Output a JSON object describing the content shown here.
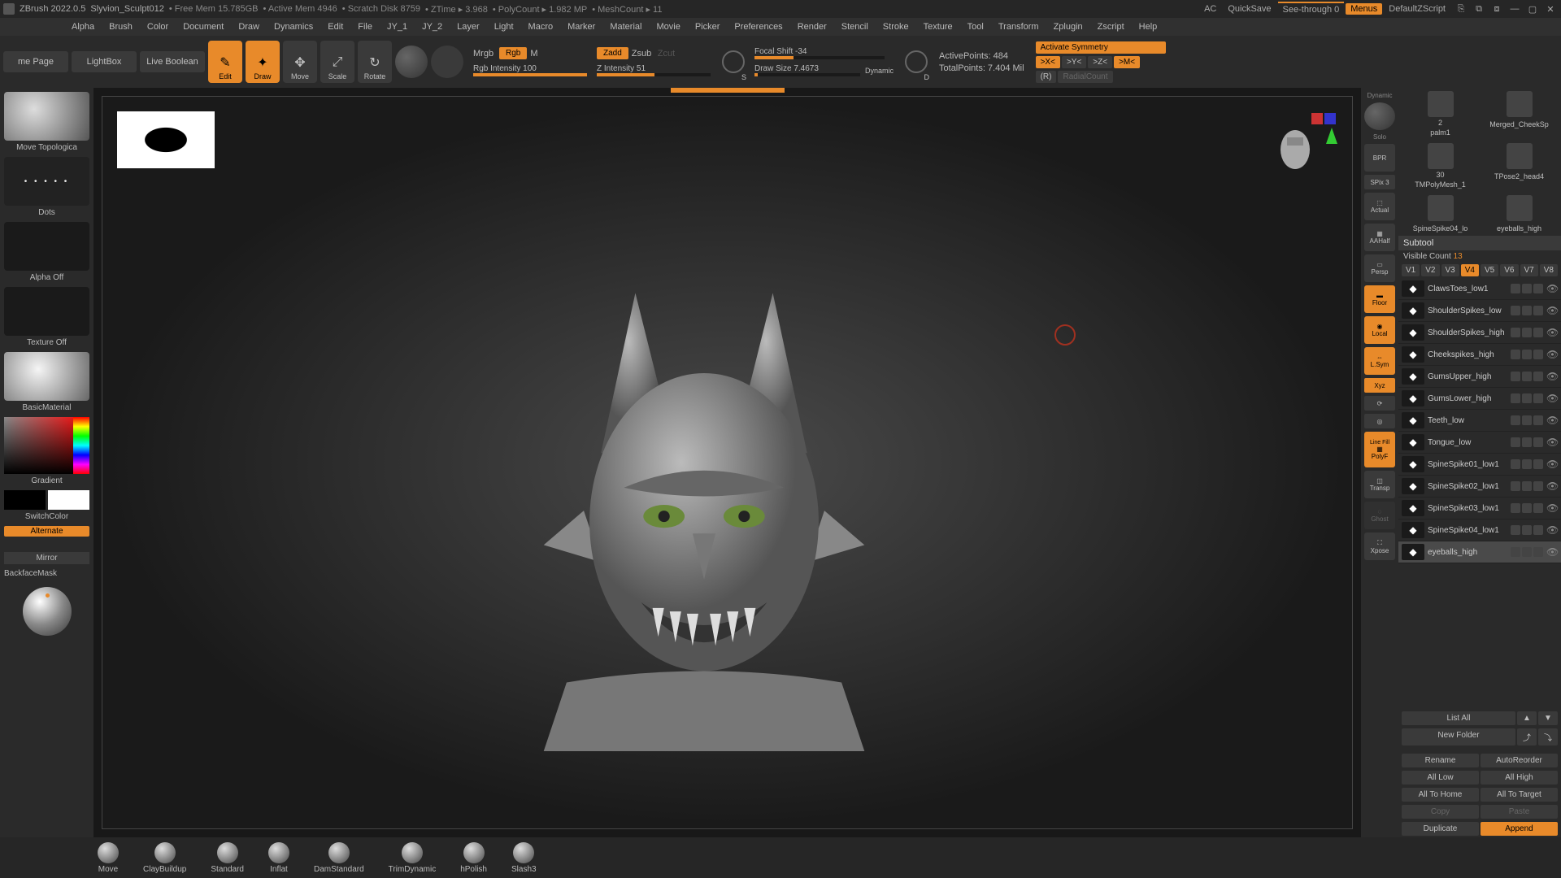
{
  "titlebar": {
    "app": "ZBrush 2022.0.5",
    "file": "Slyvion_Sculpt012",
    "stats": [
      "Free Mem 15.785GB",
      "Active Mem 4946",
      "Scratch Disk 8759",
      "ZTime ▸ 3.968",
      "PolyCount ▸ 1.982 MP",
      "MeshCount ▸ 11"
    ],
    "ac": "AC",
    "quicksave": "QuickSave",
    "seethrough": "See-through  0",
    "menus": "Menus",
    "defaultscript": "DefaultZScript"
  },
  "menubar": [
    "Alpha",
    "Brush",
    "Color",
    "Document",
    "Draw",
    "Dynamics",
    "Edit",
    "File",
    "JY_1",
    "JY_2",
    "Layer",
    "Light",
    "Macro",
    "Marker",
    "Material",
    "Movie",
    "Picker",
    "Preferences",
    "Render",
    "Stencil",
    "Stroke",
    "Texture",
    "Tool",
    "Transform",
    "Zplugin",
    "Zscript",
    "Help"
  ],
  "toolbar": {
    "homepage": "me Page",
    "lightbox": "LightBox",
    "livebool": "Live Boolean",
    "modes": [
      {
        "label": "Edit",
        "active": true
      },
      {
        "label": "Draw",
        "active": true
      },
      {
        "label": "Move",
        "active": false
      },
      {
        "label": "Scale",
        "active": false
      },
      {
        "label": "Rotate",
        "active": false
      }
    ],
    "mrgb": "Mrgb",
    "rgb": "Rgb",
    "m": "M",
    "zadd": "Zadd",
    "zsub": "Zsub",
    "zcut": "Zcut",
    "focalshift": "Focal Shift -34",
    "drawsize": "Draw Size 7.4673",
    "dynamic": "Dynamic",
    "rgbint": "Rgb Intensity 100",
    "zint": "Z Intensity 51",
    "activepoints": "ActivePoints: 484",
    "totalpoints": "TotalPoints: 7.404 Mil",
    "activatesym": "Activate Symmetry",
    "symx": ">X<",
    "symy": ">Y<",
    "symz": ">Z<",
    "symm": ">M<",
    "r": "(R)",
    "radial": "RadialCount"
  },
  "left": {
    "brush": "Move Topologica",
    "stroke": "Dots",
    "alpha": "Alpha Off",
    "texture": "Texture Off",
    "material": "BasicMaterial",
    "gradient": "Gradient",
    "switchcolor": "SwitchColor",
    "alternate": "Alternate",
    "mirror": "Mirror",
    "backface": "BackfaceMask"
  },
  "viewbtns": {
    "dynamic": "Dynamic",
    "solo": "Solo",
    "bpr": "BPR",
    "spix": "SPix 3",
    "actual": "Actual",
    "aahalf": "AAHalf",
    "persp": "Persp",
    "floor": "Floor",
    "local": "Local",
    "lsym": "L.Sym",
    "xyz": "Xyz",
    "polyf": "PolyF",
    "transp": "Transp",
    "ghost": "Ghost",
    "xpose": "Xpose",
    "linefill": "Line Fill"
  },
  "right": {
    "topTools": [
      {
        "label": "palm1",
        "count": "2"
      },
      {
        "label": "Merged_CheekSp"
      },
      {
        "label": "TMPolyMesh_1",
        "count": "30"
      },
      {
        "label": "TPose2_head4"
      },
      {
        "label": "SpineSpike04_lo"
      },
      {
        "label": "eyeballs_high"
      }
    ],
    "subtoolHeader": "Subtool",
    "visibleCount": "Visible Count",
    "visibleNum": "13",
    "vbtns": [
      "V1",
      "V2",
      "V3",
      "V4",
      "V5",
      "V6",
      "V7",
      "V8"
    ],
    "vActive": "V4",
    "subtools": [
      "ClawsToes_low1",
      "ShoulderSpikes_low",
      "ShoulderSpikes_high",
      "Cheekspikes_high",
      "GumsUpper_high",
      "GumsLower_high",
      "Teeth_low",
      "Tongue_low",
      "SpineSpike01_low1",
      "SpineSpike02_low1",
      "SpineSpike03_low1",
      "SpineSpike04_low1",
      "eyeballs_high"
    ],
    "activeSubtool": "eyeballs_high",
    "listAll": "List All",
    "newFolder": "New Folder",
    "rename": "Rename",
    "autoreorder": "AutoReorder",
    "alllow": "All Low",
    "allhigh": "All High",
    "alltohome": "All To Home",
    "alltotarget": "All To Target",
    "copy": "Copy",
    "paste": "Paste",
    "duplicate": "Duplicate",
    "append": "Append"
  },
  "brushes": [
    "Move",
    "ClayBuildup",
    "Standard",
    "Inflat",
    "DamStandard",
    "TrimDynamic",
    "hPolish",
    "Slash3"
  ]
}
